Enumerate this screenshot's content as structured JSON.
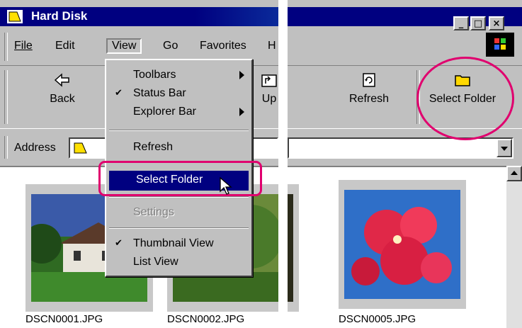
{
  "window": {
    "title": "Hard Disk",
    "minimize_glyph": "_",
    "maximize_glyph": "□",
    "close_glyph": "×"
  },
  "menubar": {
    "items": [
      {
        "label": "File"
      },
      {
        "label": "Edit"
      },
      {
        "label": "View"
      },
      {
        "label": "Go"
      },
      {
        "label": "Favorites"
      },
      {
        "label": "H"
      }
    ]
  },
  "toolbar": {
    "back_label": "Back",
    "up_label": "Up",
    "refresh_label": "Refresh",
    "select_folder_label": "Select Folder"
  },
  "address": {
    "label": "Address"
  },
  "view_menu": {
    "items": [
      {
        "label": "Toolbars",
        "checked": false,
        "submenu": true
      },
      {
        "label": "Status Bar",
        "checked": true,
        "submenu": false
      },
      {
        "label": "Explorer Bar",
        "checked": false,
        "submenu": true
      },
      {
        "label": "Refresh",
        "checked": false,
        "submenu": false
      },
      {
        "label": "Select Folder",
        "checked": false,
        "submenu": false,
        "highlighted": true
      },
      {
        "label": "Settings",
        "checked": false,
        "submenu": false,
        "disabled": true
      },
      {
        "label": "Thumbnail View",
        "checked": true,
        "submenu": false
      },
      {
        "label": "List View",
        "checked": false,
        "submenu": false
      }
    ],
    "check_glyph": "✔"
  },
  "files": [
    {
      "name": "DSCN0001.JPG"
    },
    {
      "name": "DSCN0002.JPG"
    },
    {
      "name": "DSCN0005.JPG"
    }
  ],
  "colors": {
    "titlebar": "#000080",
    "annotation": "#e0006e",
    "menu_highlight": "#000080"
  }
}
